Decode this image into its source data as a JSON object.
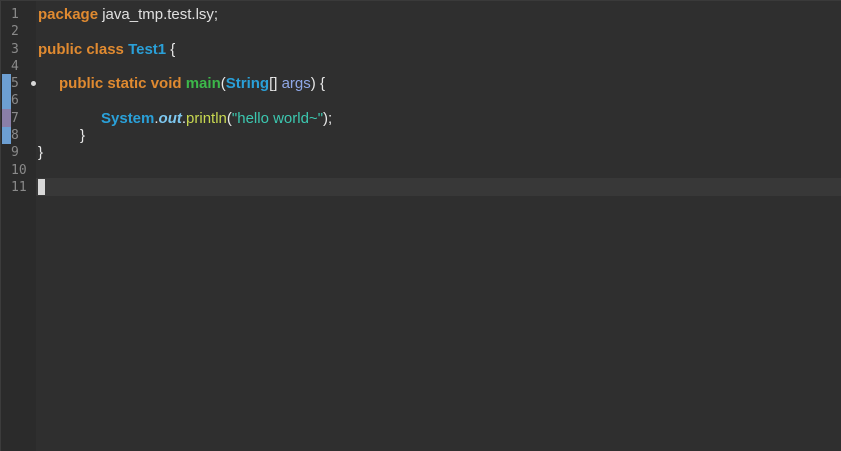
{
  "editor": {
    "line_numbers": [
      "1",
      "2",
      "3",
      "4",
      "5",
      "6",
      "7",
      "8",
      "9",
      "10",
      "11"
    ],
    "lines": {
      "l1": {
        "kw": "package",
        "rest": " java_tmp.test.lsy;"
      },
      "l3": {
        "kw1": "public",
        "kw2": "class",
        "cls": "Test1",
        "rest": " {"
      },
      "l5": {
        "kw1": "public",
        "kw2": "static",
        "kw3": "void",
        "method": "main",
        "open": "(",
        "type": "String",
        "arr": "[] ",
        "param": "args",
        "close": ") {"
      },
      "l7": {
        "cls": "System",
        "dot1": ".",
        "field": "out",
        "dot2": ".",
        "call": "println",
        "open": "(",
        "str": "\"hello world~\"",
        "close": ");"
      },
      "l8": {
        "text": "}"
      },
      "l9": {
        "text": "}"
      }
    }
  }
}
